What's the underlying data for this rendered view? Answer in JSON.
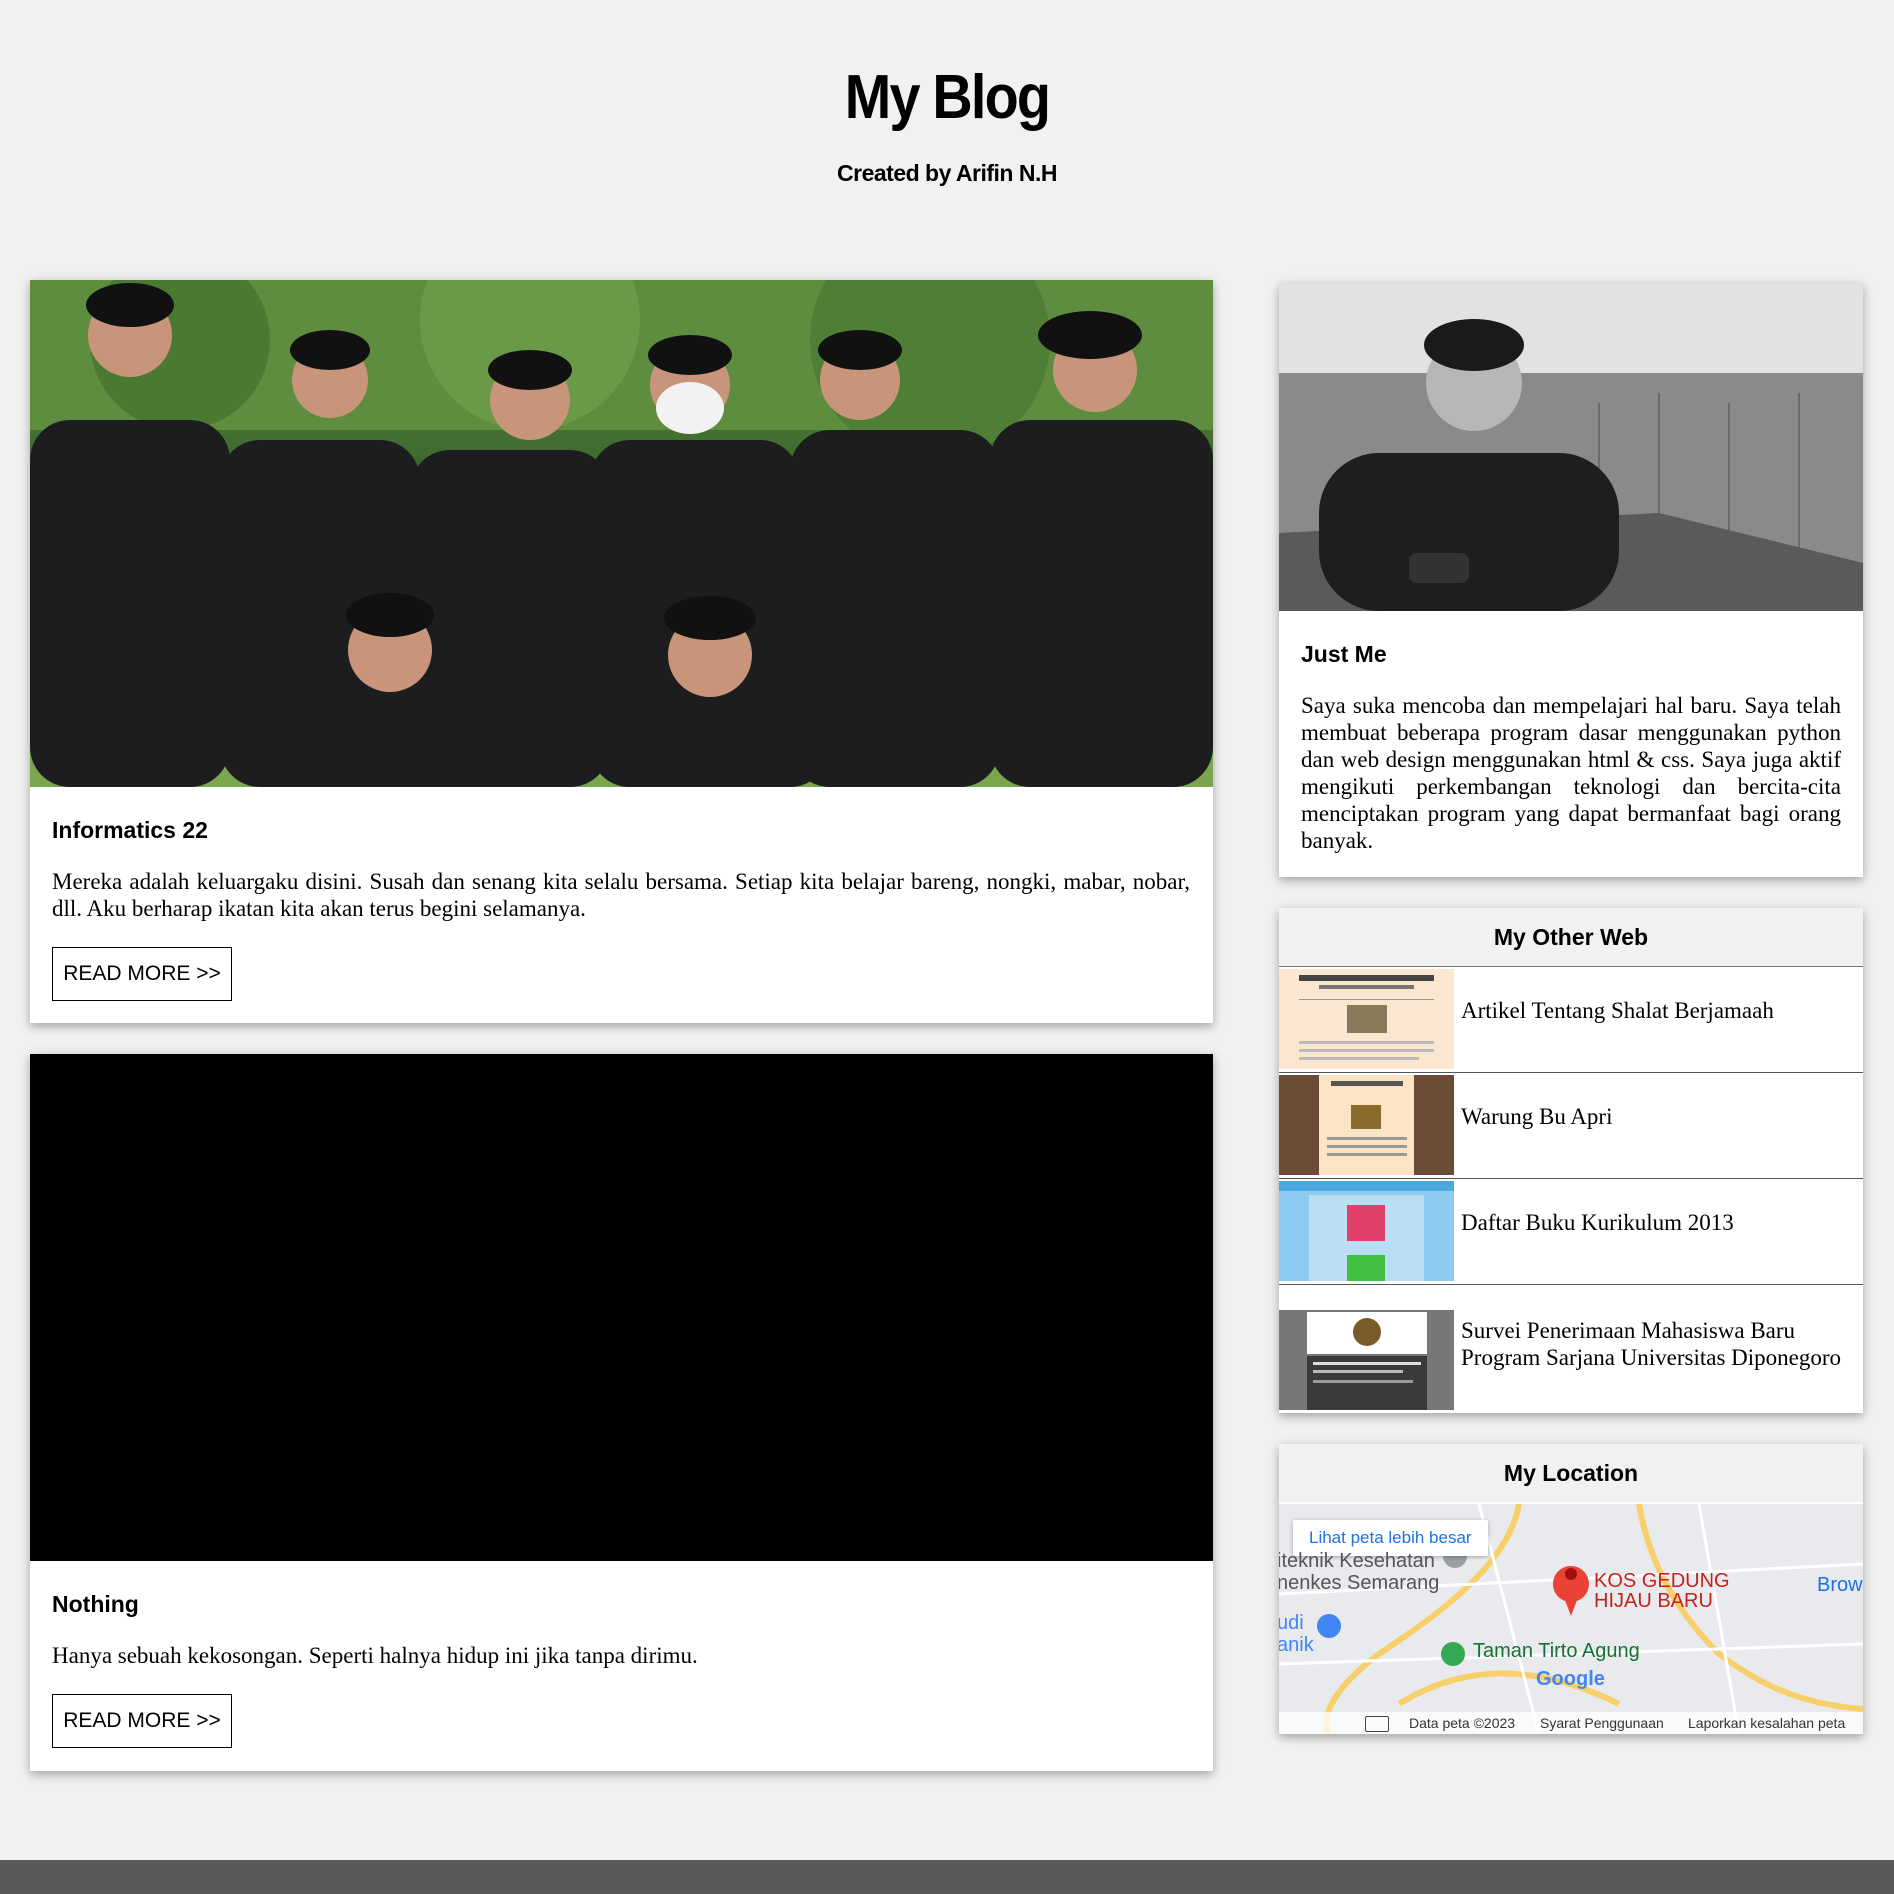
{
  "header": {
    "title": "My Blog",
    "subtitle": "Created by Arifin N.H"
  },
  "posts": [
    {
      "title": "Informatics 22",
      "text": "Mereka adalah keluargaku disini. Susah dan senang kita selalu bersama. Setiap kita belajar bareng, nongki, mabar, nobar, dll. Aku berharap ikatan kita akan terus begini selamanya.",
      "button": "READ MORE >>"
    },
    {
      "title": "Nothing",
      "text": "Hanya sebuah kekosongan. Seperti halnya hidup ini jika tanpa dirimu.",
      "button": "READ MORE >>"
    }
  ],
  "about": {
    "title": "Just Me",
    "text": "Saya suka mencoba dan mempelajari hal baru. Saya telah membuat beberapa program dasar menggunakan python dan web design menggunakan html & css. Saya juga aktif mengikuti perkembangan teknologi dan bercita-cita menciptakan program yang dapat bermanfaat bagi orang banyak."
  },
  "other_web": {
    "title": "My Other Web",
    "items": [
      {
        "label": "Artikel Tentang Shalat Berjamaah"
      },
      {
        "label": "Warung Bu Apri"
      },
      {
        "label": "Daftar Buku Kurikulum 2013"
      },
      {
        "label": "Survei Penerimaan Mahasiswa Baru Program Sarjana Universitas Diponegoro"
      }
    ]
  },
  "location": {
    "title": "My Location",
    "map_link": "Lihat peta lebih besar",
    "place_name_1": "KOS GEDUNG",
    "place_name_2": "HIJAU BARU",
    "poi_1": "iteknik Kesehatan",
    "poi_2": "nenkes Semarang",
    "poi_3": "Taman Tirto Agung",
    "poi_4": "udi",
    "poi_5": "anik",
    "poi_6": "Brow",
    "brand": "Google",
    "footer_data": "Data peta ©2023",
    "footer_terms": "Syarat Penggunaan",
    "footer_report": "Laporkan kesalahan peta"
  },
  "colors": {
    "background": "#f1f1f1",
    "footer": "#595959",
    "map_pin": "#ea4335",
    "map_link": "#1a73e8"
  }
}
